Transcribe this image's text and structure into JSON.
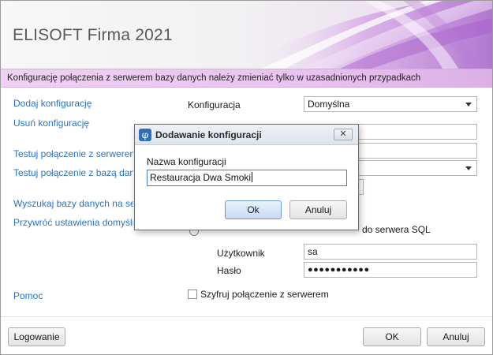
{
  "window": {
    "title": "ELISOFT Firma 2021"
  },
  "banner": {
    "text": "Konfigurację połączenia z serwerem bazy danych należy zmieniać tylko w uzasadnionych przypadkach"
  },
  "sidebar": {
    "items": [
      {
        "label": "Dodaj konfigurację"
      },
      {
        "label": "Usuń konfigurację"
      },
      {
        "label": "Testuj połączenie z serwerem"
      },
      {
        "label": "Testuj połączenie z bazą danych"
      },
      {
        "label": "Wyszukaj bazy danych na serwerze"
      },
      {
        "label": "Przywróć ustawienia domyślne"
      },
      {
        "label": "Pomoc"
      }
    ]
  },
  "form": {
    "config_label": "Konfiguracja",
    "config_value": "Domyślna",
    "sql_auth_text": "do serwera SQL",
    "user_label": "Użytkownik",
    "user_value": "sa",
    "password_label": "Hasło",
    "password_value": "●●●●●●●●●●●",
    "encrypt_label": "Szyfruj połączenie z serwerem"
  },
  "footer": {
    "login_button": "Logowanie",
    "ok_button": "OK",
    "cancel_button": "Anuluj"
  },
  "dialog": {
    "title": "Dodawanie konfiguracji",
    "icon_glyph": "φ",
    "close_glyph": "✕",
    "field_label": "Nazwa konfiguracji",
    "field_value": "Restauracja Dwa Smoki",
    "ok_button": "Ok",
    "cancel_button": "Anuluj"
  },
  "colors": {
    "link": "#2a74c8",
    "banner": "#ecc8f1",
    "accent_purple": "#b36fd0"
  }
}
